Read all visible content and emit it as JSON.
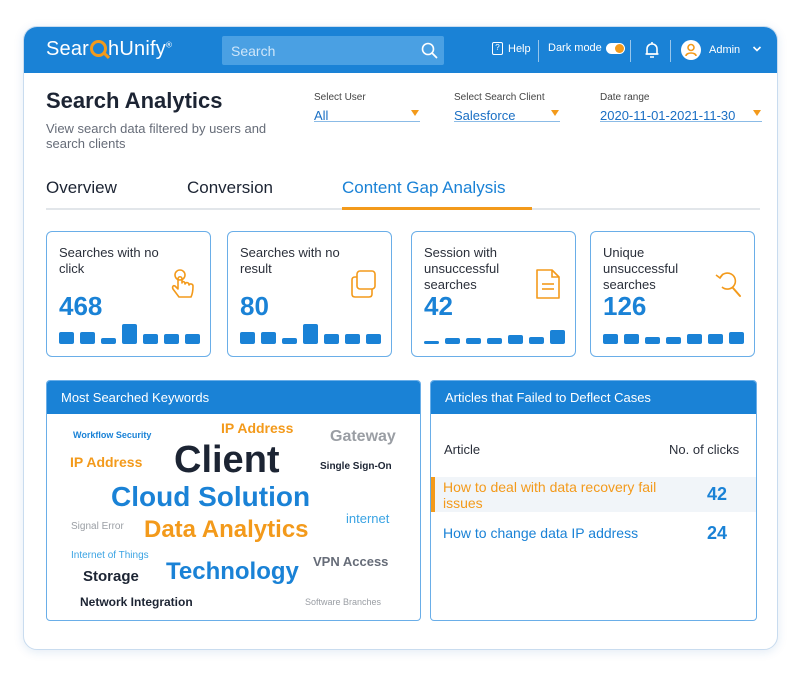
{
  "colors": {
    "brand_blue": "#1a82d6",
    "accent_orange": "#f39a1b",
    "text_dark": "#1c2433",
    "text_gray": "#9a9ea4"
  },
  "topbar": {
    "logo_prefix": "Sear",
    "logo_suffix": "hUnify",
    "logo_mark": "®",
    "search_placeholder": "Search",
    "help_label": "Help",
    "dark_mode_label": "Dark mode",
    "dark_mode_on": true,
    "user_name": "Admin"
  },
  "header": {
    "title": "Search Analytics",
    "subtitle": "View search data filtered by users and search clients"
  },
  "filters": {
    "user": {
      "label": "Select User",
      "value": "All"
    },
    "client": {
      "label": "Select Search Client",
      "value": "Salesforce"
    },
    "date": {
      "label": "Date range",
      "value": "2020-11-01-2021-11-30"
    }
  },
  "tabs": [
    {
      "label": "Overview",
      "active": false
    },
    {
      "label": "Conversion",
      "active": false
    },
    {
      "label": "Content Gap Analysis",
      "active": true
    }
  ],
  "metrics": [
    {
      "title": "Searches with no click",
      "value": "468",
      "icon": "hand-tap-icon",
      "bars": [
        0.55,
        0.55,
        0.25,
        0.9,
        0.45,
        0.45,
        0.45
      ]
    },
    {
      "title": "Searches with no result",
      "value": "80",
      "icon": "copy-squares-icon",
      "bars": [
        0.55,
        0.55,
        0.25,
        0.9,
        0.45,
        0.45,
        0.45
      ]
    },
    {
      "title": "Session with unsuccessful searches",
      "value": "42",
      "icon": "document-icon",
      "bars": [
        0.15,
        0.25,
        0.25,
        0.25,
        0.4,
        0.3,
        0.65
      ]
    },
    {
      "title": "Unique unsuccessful searches",
      "value": "126",
      "icon": "search-refresh-icon",
      "bars": [
        0.45,
        0.45,
        0.3,
        0.3,
        0.45,
        0.45,
        0.55
      ]
    }
  ],
  "keywords_panel": {
    "title": "Most Searched Keywords",
    "words": [
      {
        "text": "Workflow Security",
        "color": "#1a82d6"
      },
      {
        "text": "IP Address",
        "color": "#f39a1b"
      },
      {
        "text": "Gateway",
        "color": "#9a9ea4"
      },
      {
        "text": "IP Address",
        "color": "#f39a1b"
      },
      {
        "text": "Client",
        "color": "#1c2433"
      },
      {
        "text": "Single Sign-On",
        "color": "#1c2433"
      },
      {
        "text": "Cloud Solution",
        "color": "#1a82d6"
      },
      {
        "text": "Signal Error",
        "color": "#9a9ea4"
      },
      {
        "text": "Data Analytics",
        "color": "#f39a1b"
      },
      {
        "text": "internet",
        "color": "#3aa3e3"
      },
      {
        "text": "Internet of Things",
        "color": "#3aa3e3"
      },
      {
        "text": "VPN Access",
        "color": "#666c78"
      },
      {
        "text": "Storage",
        "color": "#1c2433"
      },
      {
        "text": "Technology",
        "color": "#1a82d6"
      },
      {
        "text": "Network Integration",
        "color": "#1c2433"
      },
      {
        "text": "Software Branches",
        "color": "#9a9ea4"
      }
    ]
  },
  "articles_panel": {
    "title": "Articles that Failed to Deflect Cases",
    "col_article": "Article",
    "col_clicks": "No. of clicks",
    "rows": [
      {
        "title": "How to deal with data recovery fail issues",
        "clicks": "42",
        "highlighted": true
      },
      {
        "title": "How to change data IP address",
        "clicks": "24",
        "highlighted": false
      }
    ]
  }
}
